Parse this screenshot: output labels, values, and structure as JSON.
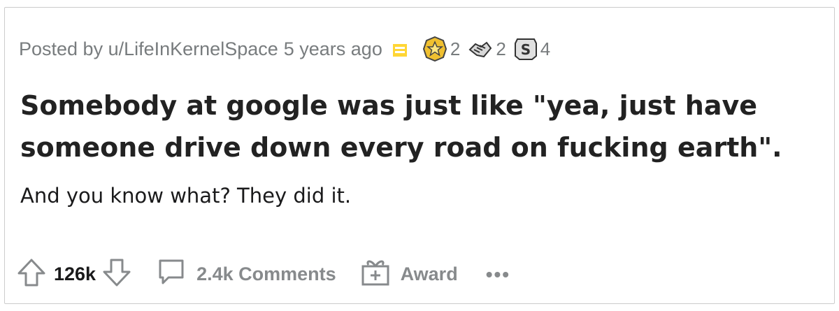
{
  "post": {
    "posted_by_prefix": "Posted by u/LifeInKernelSpace",
    "time": "5 years ago",
    "awards": [
      {
        "icon": "gold-star-award-icon",
        "count": "2"
      },
      {
        "icon": "handshake-award-icon",
        "count": "2"
      },
      {
        "icon": "silver-s-award-icon",
        "count": "4"
      }
    ],
    "title": "Somebody at google was just like \"yea, just have someone drive down every road on fucking earth\".",
    "body": "And you know what? They did it."
  },
  "actions": {
    "score": "126k",
    "comments": "2.4k Comments",
    "award": "Award",
    "more": "•••"
  },
  "colors": {
    "meta_gray": "#787c7e",
    "action_gray": "#878a8c",
    "flair_yellow": "#ffd635",
    "gold": "#f0c030"
  }
}
